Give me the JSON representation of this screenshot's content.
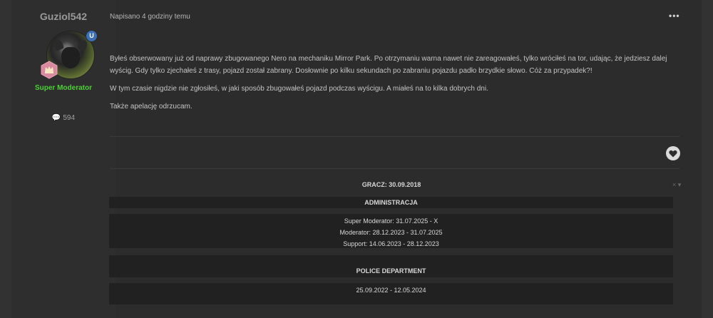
{
  "author": {
    "username": "Guziol542",
    "rank_badge_glyph": "U",
    "role_title": "Super Moderator",
    "post_count": "594"
  },
  "post": {
    "meta": "Napisano 4 godziny temu",
    "more_menu": "•••",
    "paragraphs": [
      "Byłeś obserwowany już od naprawy zbugowanego Nero na mechaniku Mirror Park. Po otrzymaniu warna nawet nie zareagowałeś, tylko wróciłeś na tor, udając, że jedziesz dalej wyścig. Gdy tylko zjechałeś z trasy, pojazd został zabrany. Dosłownie po kilku sekundach po zabraniu pojazdu padło brzydkie słowo. Cóż za przypadek?!",
      "W tym czasie nigdzie nie zgłosiłeś, w jaki sposób zbugowałeś pojazd podczas wyścigu. A miałeś na to kilka dobrych dni.",
      "Także apelację odrzucam."
    ]
  },
  "signature": {
    "close_glyph": "× ▾",
    "title": "GRACZ: 30.09.2018",
    "admin_header": "ADMINISTRACJA",
    "admin_roles": [
      "Super Moderator: 31.07.2025 - X",
      "Moderator: 28.12.2023 - 31.07.2025",
      "Support: 14.06.2023 - 28.12.2023"
    ],
    "pd_header": "POLICE DEPARTMENT",
    "pd_dates": "25.09.2022 - 12.05.2024"
  },
  "colors": {
    "background": "#323232",
    "panel": "#2c2c2c",
    "box": "#212121",
    "role_green": "#4cd137",
    "rank_blue": "#3d6fb5"
  }
}
